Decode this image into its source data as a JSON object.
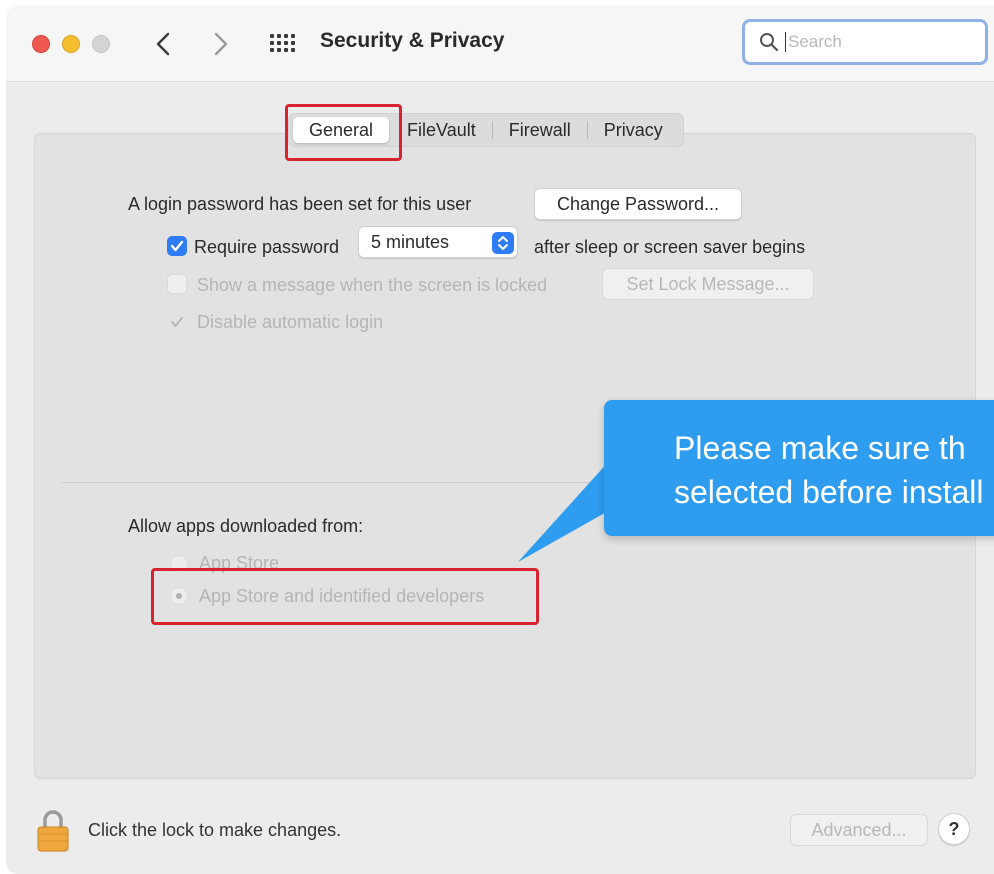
{
  "window": {
    "title": "Security & Privacy",
    "search_placeholder": "Search"
  },
  "tabs": [
    {
      "label": "General",
      "active": true
    },
    {
      "label": "FileVault",
      "active": false
    },
    {
      "label": "Firewall",
      "active": false
    },
    {
      "label": "Privacy",
      "active": false
    }
  ],
  "general": {
    "login_text": "A login password has been set for this user",
    "change_password_button": "Change Password...",
    "require_password_label": "Require password",
    "require_password_checked": true,
    "require_password_delay": "5 minutes",
    "after_sleep_text": "after sleep or screen saver begins",
    "show_message_label": "Show a message when the screen is locked",
    "show_message_checked": false,
    "set_lock_message_button": "Set Lock Message...",
    "disable_auto_login_label": "Disable automatic login",
    "disable_auto_login_checked": true
  },
  "allow_apps": {
    "heading": "Allow apps downloaded from:",
    "options": [
      {
        "label": "App Store",
        "selected": false
      },
      {
        "label": "App Store and identified developers",
        "selected": true
      }
    ]
  },
  "callout": {
    "line1": "Please make sure th",
    "line2": "selected before install"
  },
  "footer": {
    "lock_text": "Click the lock to make changes.",
    "advanced_button": "Advanced...",
    "help_button": "?"
  },
  "colors": {
    "accent": "#2f7cf6",
    "highlight_box": "#d8242e",
    "callout_bg": "#2e9df0"
  }
}
